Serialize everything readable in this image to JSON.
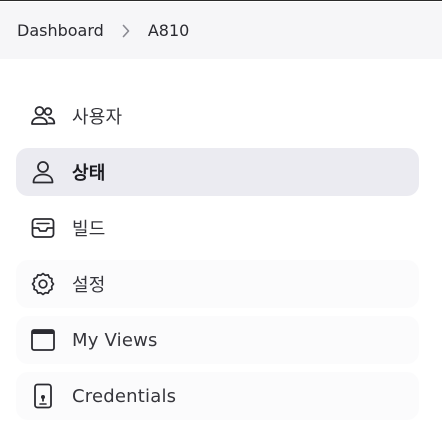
{
  "breadcrumb": {
    "items": [
      {
        "label": "Dashboard"
      },
      {
        "label": "A810"
      }
    ],
    "separator_icon": "chevron-right-icon"
  },
  "sidebar": {
    "items": [
      {
        "label": "사용자",
        "icon": "users-icon",
        "active": false
      },
      {
        "label": "상태",
        "icon": "person-icon",
        "active": true
      },
      {
        "label": "빌드",
        "icon": "inbox-icon",
        "active": false
      },
      {
        "label": "설정",
        "icon": "gear-icon",
        "active": false
      },
      {
        "label": "My Views",
        "icon": "window-icon",
        "active": false
      },
      {
        "label": "Credentials",
        "icon": "phone-icon",
        "active": false
      }
    ]
  },
  "colors": {
    "breadcrumb_bg": "#f6f6f8",
    "active_item_bg": "#ebebf1",
    "text": "#35353b"
  }
}
